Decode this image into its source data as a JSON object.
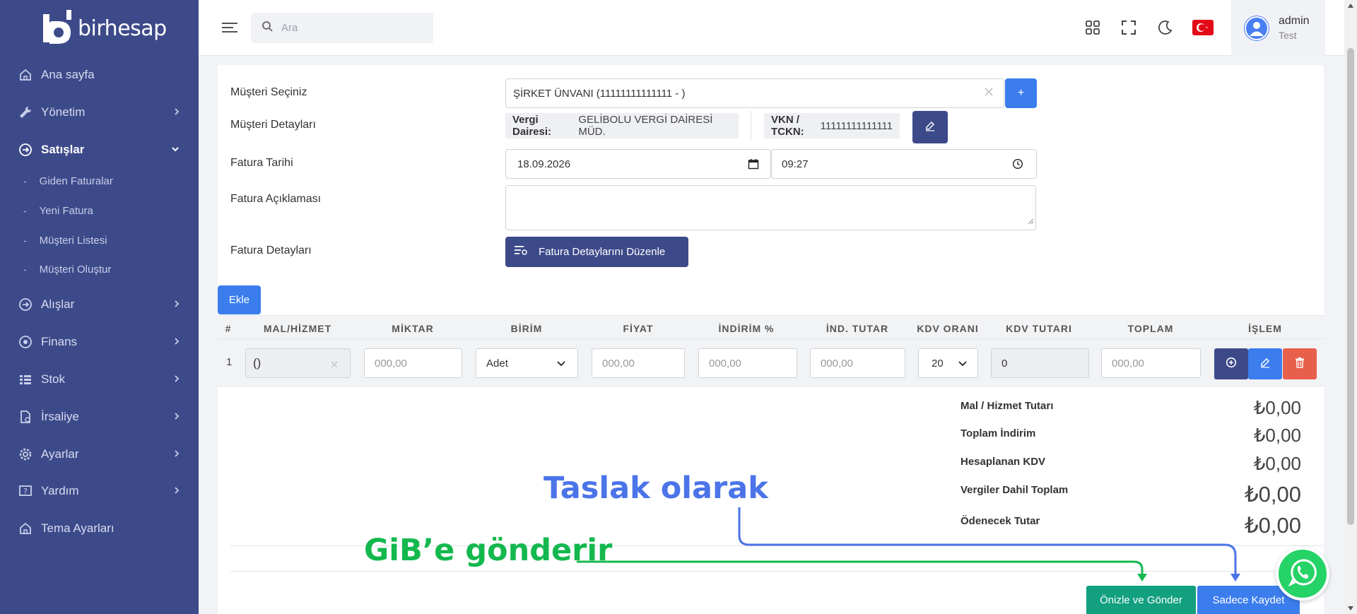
{
  "sidebar": {
    "brand": "birhesap",
    "items": [
      {
        "label": "Ana sayfa",
        "icon": "home-icon"
      },
      {
        "label": "Yönetim",
        "icon": "wrench-icon"
      },
      {
        "label": "Satışlar",
        "icon": "arrow-circle-icon"
      },
      {
        "label": "Alışlar",
        "icon": "arrow-circle-icon"
      },
      {
        "label": "Finans",
        "icon": "coin-icon"
      },
      {
        "label": "Stok",
        "icon": "list-icon"
      },
      {
        "label": "İrsaliye",
        "icon": "document-icon"
      },
      {
        "label": "Ayarlar",
        "icon": "gear-icon"
      },
      {
        "label": "Yardım",
        "icon": "help-icon"
      },
      {
        "label": "Tema Ayarları",
        "icon": "home-icon"
      }
    ],
    "sub_items": [
      "Giden Faturalar",
      "Yeni Fatura",
      "Müşteri Listesi",
      "Müşteri Oluştur"
    ]
  },
  "header": {
    "search_placeholder": "Ara",
    "user_name": "admin",
    "user_role": "Test"
  },
  "form": {
    "customer_label": "Müşteri Seçiniz",
    "customer_value": "ŞİRKET ÜNVANI (11111111111111 - )",
    "add_button": "+",
    "details_label": "Müşteri Detayları",
    "tax_office_key": "Vergi Dairesi:",
    "tax_office_value": "GELİBOLU VERGİ DAİRESİ MÜD.",
    "vkn_key": "VKN / TCKN:",
    "vkn_value": "11111111111111",
    "date_label": "Fatura Tarihi",
    "date_value": "18.09.2026",
    "time_value": "09:27",
    "desc_label": "Fatura Açıklaması",
    "invoice_details_label": "Fatura Detayları",
    "invoice_details_button": "Fatura Detaylarını Düzenle",
    "add_row_button": "Ekle"
  },
  "table": {
    "headers": [
      "#",
      "MAL/HİZMET",
      "MİKTAR",
      "BİRİM",
      "FİYAT",
      "İNDİRİM %",
      "İND. TUTAR",
      "KDV ORANI",
      "KDV TUTARI",
      "TOPLAM",
      "İŞLEM"
    ],
    "row": {
      "index": "1",
      "item": "()",
      "quantity_ph": "000,00",
      "unit": "Adet",
      "price_ph": "000,00",
      "discount_pct_ph": "000,00",
      "discount_amt_ph": "000,00",
      "vat_rate": "20",
      "vat_amount": "0",
      "total_ph": "000,00"
    }
  },
  "totals": [
    {
      "label": "Mal / Hizmet Tutarı",
      "value": "₺0,00"
    },
    {
      "label": "Toplam İndirim",
      "value": "₺0,00"
    },
    {
      "label": "Hesaplanan KDV",
      "value": "₺0,00"
    },
    {
      "label": "Vergiler Dahil Toplam",
      "value": "₺0,00"
    },
    {
      "label": "Ödenecek Tutar",
      "value": "₺0,00"
    }
  ],
  "annotations": {
    "blue": "Taslak olarak",
    "green": "GiB’e gönderir"
  },
  "buttons": {
    "preview_send": "Önizle ve Gönder",
    "save_only": "Sadece Kaydet"
  },
  "colors": {
    "sidebar": "#3d4a8a",
    "primary": "#3b7ded",
    "success": "#12a07f",
    "danger": "#e8604c",
    "annotation_blue": "#4b74e8",
    "annotation_green": "#14b84e"
  }
}
